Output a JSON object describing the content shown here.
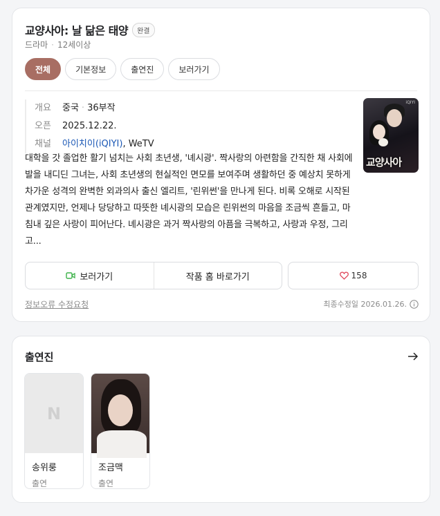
{
  "header": {
    "title": "교양사아: 날 닮은 태양",
    "status_badge": "완결",
    "genre": "드라마",
    "rating": "12세이상"
  },
  "tabs": [
    {
      "label": "전체",
      "active": true
    },
    {
      "label": "기본정보",
      "active": false
    },
    {
      "label": "출연진",
      "active": false
    },
    {
      "label": "보러가기",
      "active": false
    }
  ],
  "info": {
    "overview_key": "개요",
    "overview_country": "중국",
    "overview_episodes": "36부작",
    "open_key": "오픈",
    "open_date": "2025.12.22.",
    "channel_key": "채널",
    "channel_link": "아이치이(iQIYI)",
    "channel_rest": ", WeTV"
  },
  "poster": {
    "title_text": "교양사아",
    "logo": "iQIYI"
  },
  "synopsis": "대학을 갓 졸업한 활기 넘치는 사회 초년생, '녜시광'. 짝사랑의 아련함을 간직한 채 사회에 발을 내디딘 그녀는, 사회 초년생의 현실적인 면모를 보여주며 생활하던 중 예상치 못하게 차가운 성격의 완벽한 외과의사 출신 엘리트, '린위썬'을 만나게 된다. 비록 오해로 시작된 관계였지만, 언제나 당당하고 따뜻한 녜시광의 모습은 린위썬의 마음을 조금씩 흔들고, 마침내 깊은 사랑이 피어난다. 녜시광은 과거 짝사랑의 아픔을 극복하고, 사랑과 우정, 그리고...",
  "actions": {
    "watch_label": "보러가기",
    "homepage_label": "작품 홈 바로가기",
    "like_count": "158"
  },
  "footer": {
    "report_label": "정보오류 수정요청",
    "updated_label": "최종수정일 2026.01.26."
  },
  "cast_section": {
    "title": "출연진",
    "members": [
      {
        "name": "송위룽",
        "role": "출연",
        "photo": "placeholder",
        "placeholder_glyph": "N"
      },
      {
        "name": "조금맥",
        "role": "출연",
        "photo": "portrait"
      }
    ]
  },
  "colors": {
    "active_tab": "#a86e63",
    "link": "#1a57b5",
    "play_icon": "#3db24a",
    "heart_icon": "#e0465a"
  }
}
